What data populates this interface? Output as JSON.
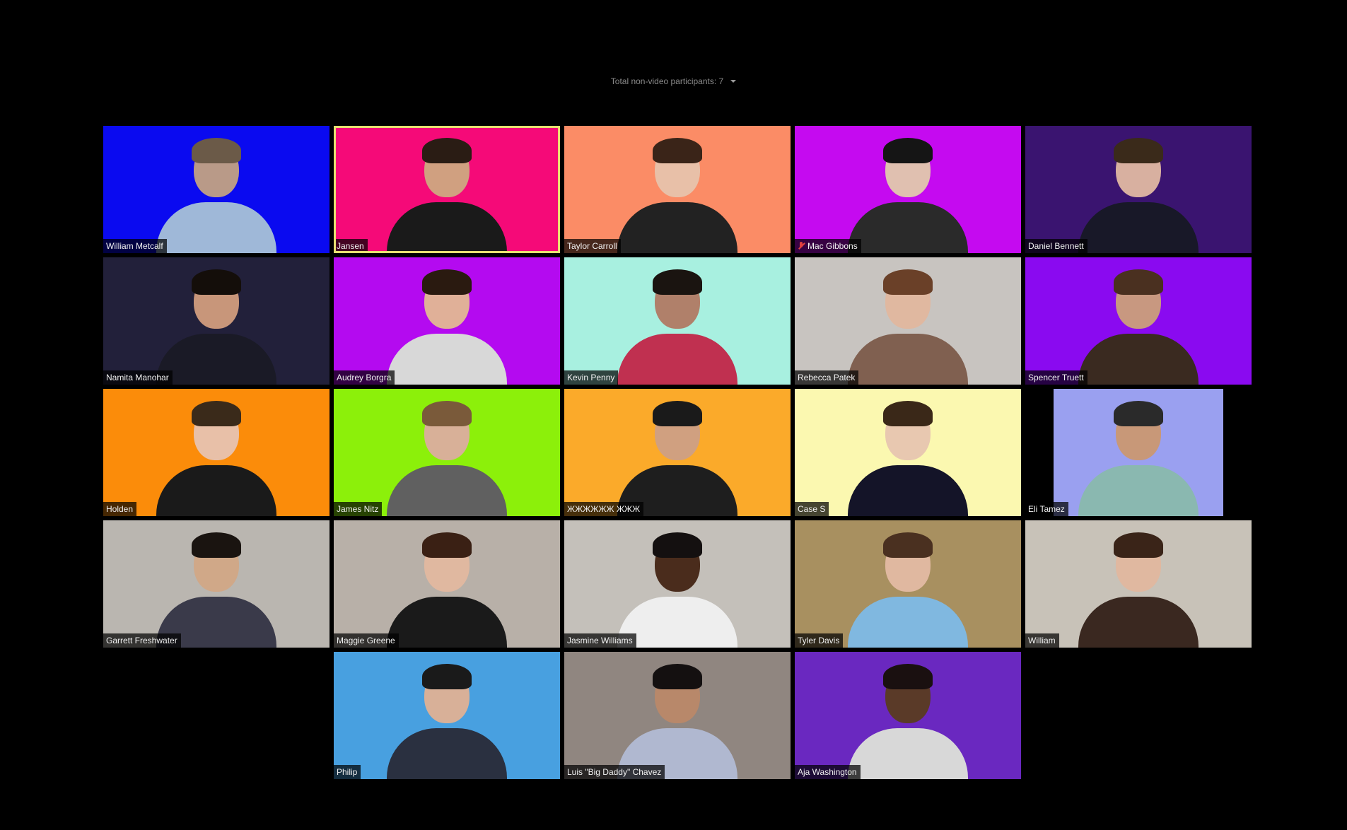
{
  "header": {
    "non_video_label": "Total non-video participants: 7"
  },
  "rows": [
    [
      {
        "name": "William Metcalf",
        "bg": "#0a0af0",
        "skin": "#b99a88",
        "hair": "#6b5a48",
        "shirt": "#9fb8d8",
        "muted": false,
        "active": false
      },
      {
        "name": "Jansen",
        "bg": "#f50a78",
        "skin": "#d0a080",
        "hair": "#2a1c14",
        "shirt": "#1a1a1a",
        "muted": false,
        "active": true
      },
      {
        "name": "Taylor Carroll",
        "bg": "#fb8c66",
        "skin": "#e8c0a8",
        "hair": "#3a2418",
        "shirt": "#222222",
        "muted": false,
        "active": false
      },
      {
        "name": "Mac Gibbons",
        "bg": "#c50af0",
        "skin": "#e0c0b0",
        "hair": "#151515",
        "shirt": "#2a2a2a",
        "muted": true,
        "active": false
      },
      {
        "name": "Daniel Bennett",
        "bg": "#3a1470",
        "skin": "#d8b0a0",
        "hair": "#3a2a1a",
        "shirt": "#181828",
        "muted": false,
        "active": false
      }
    ],
    [
      {
        "name": "Namita Manohar",
        "bg": "#22203a",
        "skin": "#c8967a",
        "hair": "#140e0a",
        "shirt": "#1a1a26",
        "muted": false,
        "active": false
      },
      {
        "name": "Audrey Borgra",
        "bg": "#b40af0",
        "skin": "#e0b098",
        "hair": "#2a1a10",
        "shirt": "#d8d8d8",
        "muted": false,
        "active": false
      },
      {
        "name": "Kevin Penny",
        "bg": "#a8f0e0",
        "skin": "#b0806a",
        "hair": "#1a1410",
        "shirt": "#c03050",
        "muted": false,
        "active": false
      },
      {
        "name": "Rebecca Patek",
        "bg": "#c8c4c0",
        "skin": "#e0b8a0",
        "hair": "#6a4028",
        "shirt": "#806050",
        "muted": false,
        "active": false
      },
      {
        "name": "Spencer Truett",
        "bg": "#8a0af0",
        "skin": "#c89880",
        "hair": "#4a3020",
        "shirt": "#3a2a20",
        "muted": false,
        "active": false
      }
    ],
    [
      {
        "name": "Holden",
        "bg": "#fb8c0a",
        "skin": "#e8c0a8",
        "hair": "#3a2a1a",
        "shirt": "#1a1a1a",
        "muted": false,
        "active": false
      },
      {
        "name": "James Nitz",
        "bg": "#8cf00a",
        "skin": "#d8b098",
        "hair": "#7a5a3a",
        "shirt": "#606060",
        "muted": false,
        "active": false
      },
      {
        "name": "ЖЖЖЖЖЖ ЖЖЖ",
        "bg": "#fbaa2a",
        "skin": "#d0a080",
        "hair": "#1a1a1a",
        "shirt": "#1e1e1e",
        "muted": false,
        "active": false
      },
      {
        "name": "Case S",
        "bg": "#fbf8b0",
        "skin": "#e8c8b0",
        "hair": "#3a2818",
        "shirt": "#141428",
        "muted": false,
        "active": false
      },
      {
        "name": "Eli Tamez",
        "bg": "#9aa0f0",
        "skin": "#c89878",
        "hair": "#2a2a2a",
        "shirt": "#8ab8b0",
        "muted": false,
        "active": false,
        "narrow": true
      }
    ],
    [
      {
        "name": "Garrett Freshwater",
        "bg": "#bab6b0",
        "skin": "#d0a888",
        "hair": "#1a1410",
        "shirt": "#3a3a4a",
        "muted": false,
        "active": false
      },
      {
        "name": "Maggie Greene",
        "bg": "#b8b0a8",
        "skin": "#e0b8a0",
        "hair": "#3a2014",
        "shirt": "#1a1a1a",
        "muted": false,
        "active": false
      },
      {
        "name": "Jasmine Williams",
        "bg": "#c4c0ba",
        "skin": "#4a2c1c",
        "hair": "#141010",
        "shirt": "#eeeeee",
        "muted": false,
        "active": false
      },
      {
        "name": "Tyler Davis",
        "bg": "#a89060",
        "skin": "#e0b8a0",
        "hair": "#4a3020",
        "shirt": "#80b8e0",
        "muted": false,
        "active": false
      },
      {
        "name": "William",
        "bg": "#c8c2b8",
        "skin": "#e0b8a0",
        "hair": "#3a2418",
        "shirt": "#3a2820",
        "muted": false,
        "active": false
      }
    ],
    [
      {
        "name": "Philip",
        "bg": "#48a0e0",
        "skin": "#d8b098",
        "hair": "#1a1a1a",
        "shirt": "#2a3040",
        "muted": false,
        "active": false
      },
      {
        "name": "Luis \"Big Daddy\" Chavez",
        "bg": "#908680",
        "skin": "#b8886a",
        "hair": "#141010",
        "shirt": "#b0b8d0",
        "muted": false,
        "active": false
      },
      {
        "name": "Aja Washington",
        "bg": "#6a28c0",
        "skin": "#5a3a28",
        "hair": "#1a1010",
        "shirt": "#d8d8d8",
        "muted": false,
        "active": false
      }
    ]
  ]
}
